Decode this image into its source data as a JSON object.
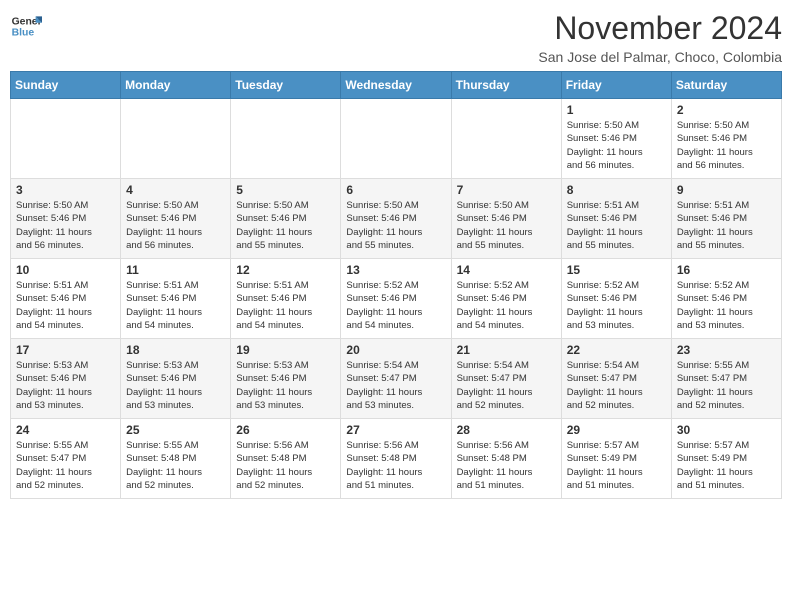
{
  "header": {
    "logo_line1": "General",
    "logo_line2": "Blue",
    "month": "November 2024",
    "location": "San Jose del Palmar, Choco, Colombia"
  },
  "weekdays": [
    "Sunday",
    "Monday",
    "Tuesday",
    "Wednesday",
    "Thursday",
    "Friday",
    "Saturday"
  ],
  "weeks": [
    [
      {
        "day": "",
        "info": ""
      },
      {
        "day": "",
        "info": ""
      },
      {
        "day": "",
        "info": ""
      },
      {
        "day": "",
        "info": ""
      },
      {
        "day": "",
        "info": ""
      },
      {
        "day": "1",
        "info": "Sunrise: 5:50 AM\nSunset: 5:46 PM\nDaylight: 11 hours\nand 56 minutes."
      },
      {
        "day": "2",
        "info": "Sunrise: 5:50 AM\nSunset: 5:46 PM\nDaylight: 11 hours\nand 56 minutes."
      }
    ],
    [
      {
        "day": "3",
        "info": "Sunrise: 5:50 AM\nSunset: 5:46 PM\nDaylight: 11 hours\nand 56 minutes."
      },
      {
        "day": "4",
        "info": "Sunrise: 5:50 AM\nSunset: 5:46 PM\nDaylight: 11 hours\nand 56 minutes."
      },
      {
        "day": "5",
        "info": "Sunrise: 5:50 AM\nSunset: 5:46 PM\nDaylight: 11 hours\nand 55 minutes."
      },
      {
        "day": "6",
        "info": "Sunrise: 5:50 AM\nSunset: 5:46 PM\nDaylight: 11 hours\nand 55 minutes."
      },
      {
        "day": "7",
        "info": "Sunrise: 5:50 AM\nSunset: 5:46 PM\nDaylight: 11 hours\nand 55 minutes."
      },
      {
        "day": "8",
        "info": "Sunrise: 5:51 AM\nSunset: 5:46 PM\nDaylight: 11 hours\nand 55 minutes."
      },
      {
        "day": "9",
        "info": "Sunrise: 5:51 AM\nSunset: 5:46 PM\nDaylight: 11 hours\nand 55 minutes."
      }
    ],
    [
      {
        "day": "10",
        "info": "Sunrise: 5:51 AM\nSunset: 5:46 PM\nDaylight: 11 hours\nand 54 minutes."
      },
      {
        "day": "11",
        "info": "Sunrise: 5:51 AM\nSunset: 5:46 PM\nDaylight: 11 hours\nand 54 minutes."
      },
      {
        "day": "12",
        "info": "Sunrise: 5:51 AM\nSunset: 5:46 PM\nDaylight: 11 hours\nand 54 minutes."
      },
      {
        "day": "13",
        "info": "Sunrise: 5:52 AM\nSunset: 5:46 PM\nDaylight: 11 hours\nand 54 minutes."
      },
      {
        "day": "14",
        "info": "Sunrise: 5:52 AM\nSunset: 5:46 PM\nDaylight: 11 hours\nand 54 minutes."
      },
      {
        "day": "15",
        "info": "Sunrise: 5:52 AM\nSunset: 5:46 PM\nDaylight: 11 hours\nand 53 minutes."
      },
      {
        "day": "16",
        "info": "Sunrise: 5:52 AM\nSunset: 5:46 PM\nDaylight: 11 hours\nand 53 minutes."
      }
    ],
    [
      {
        "day": "17",
        "info": "Sunrise: 5:53 AM\nSunset: 5:46 PM\nDaylight: 11 hours\nand 53 minutes."
      },
      {
        "day": "18",
        "info": "Sunrise: 5:53 AM\nSunset: 5:46 PM\nDaylight: 11 hours\nand 53 minutes."
      },
      {
        "day": "19",
        "info": "Sunrise: 5:53 AM\nSunset: 5:46 PM\nDaylight: 11 hours\nand 53 minutes."
      },
      {
        "day": "20",
        "info": "Sunrise: 5:54 AM\nSunset: 5:47 PM\nDaylight: 11 hours\nand 53 minutes."
      },
      {
        "day": "21",
        "info": "Sunrise: 5:54 AM\nSunset: 5:47 PM\nDaylight: 11 hours\nand 52 minutes."
      },
      {
        "day": "22",
        "info": "Sunrise: 5:54 AM\nSunset: 5:47 PM\nDaylight: 11 hours\nand 52 minutes."
      },
      {
        "day": "23",
        "info": "Sunrise: 5:55 AM\nSunset: 5:47 PM\nDaylight: 11 hours\nand 52 minutes."
      }
    ],
    [
      {
        "day": "24",
        "info": "Sunrise: 5:55 AM\nSunset: 5:47 PM\nDaylight: 11 hours\nand 52 minutes."
      },
      {
        "day": "25",
        "info": "Sunrise: 5:55 AM\nSunset: 5:48 PM\nDaylight: 11 hours\nand 52 minutes."
      },
      {
        "day": "26",
        "info": "Sunrise: 5:56 AM\nSunset: 5:48 PM\nDaylight: 11 hours\nand 52 minutes."
      },
      {
        "day": "27",
        "info": "Sunrise: 5:56 AM\nSunset: 5:48 PM\nDaylight: 11 hours\nand 51 minutes."
      },
      {
        "day": "28",
        "info": "Sunrise: 5:56 AM\nSunset: 5:48 PM\nDaylight: 11 hours\nand 51 minutes."
      },
      {
        "day": "29",
        "info": "Sunrise: 5:57 AM\nSunset: 5:49 PM\nDaylight: 11 hours\nand 51 minutes."
      },
      {
        "day": "30",
        "info": "Sunrise: 5:57 AM\nSunset: 5:49 PM\nDaylight: 11 hours\nand 51 minutes."
      }
    ]
  ]
}
